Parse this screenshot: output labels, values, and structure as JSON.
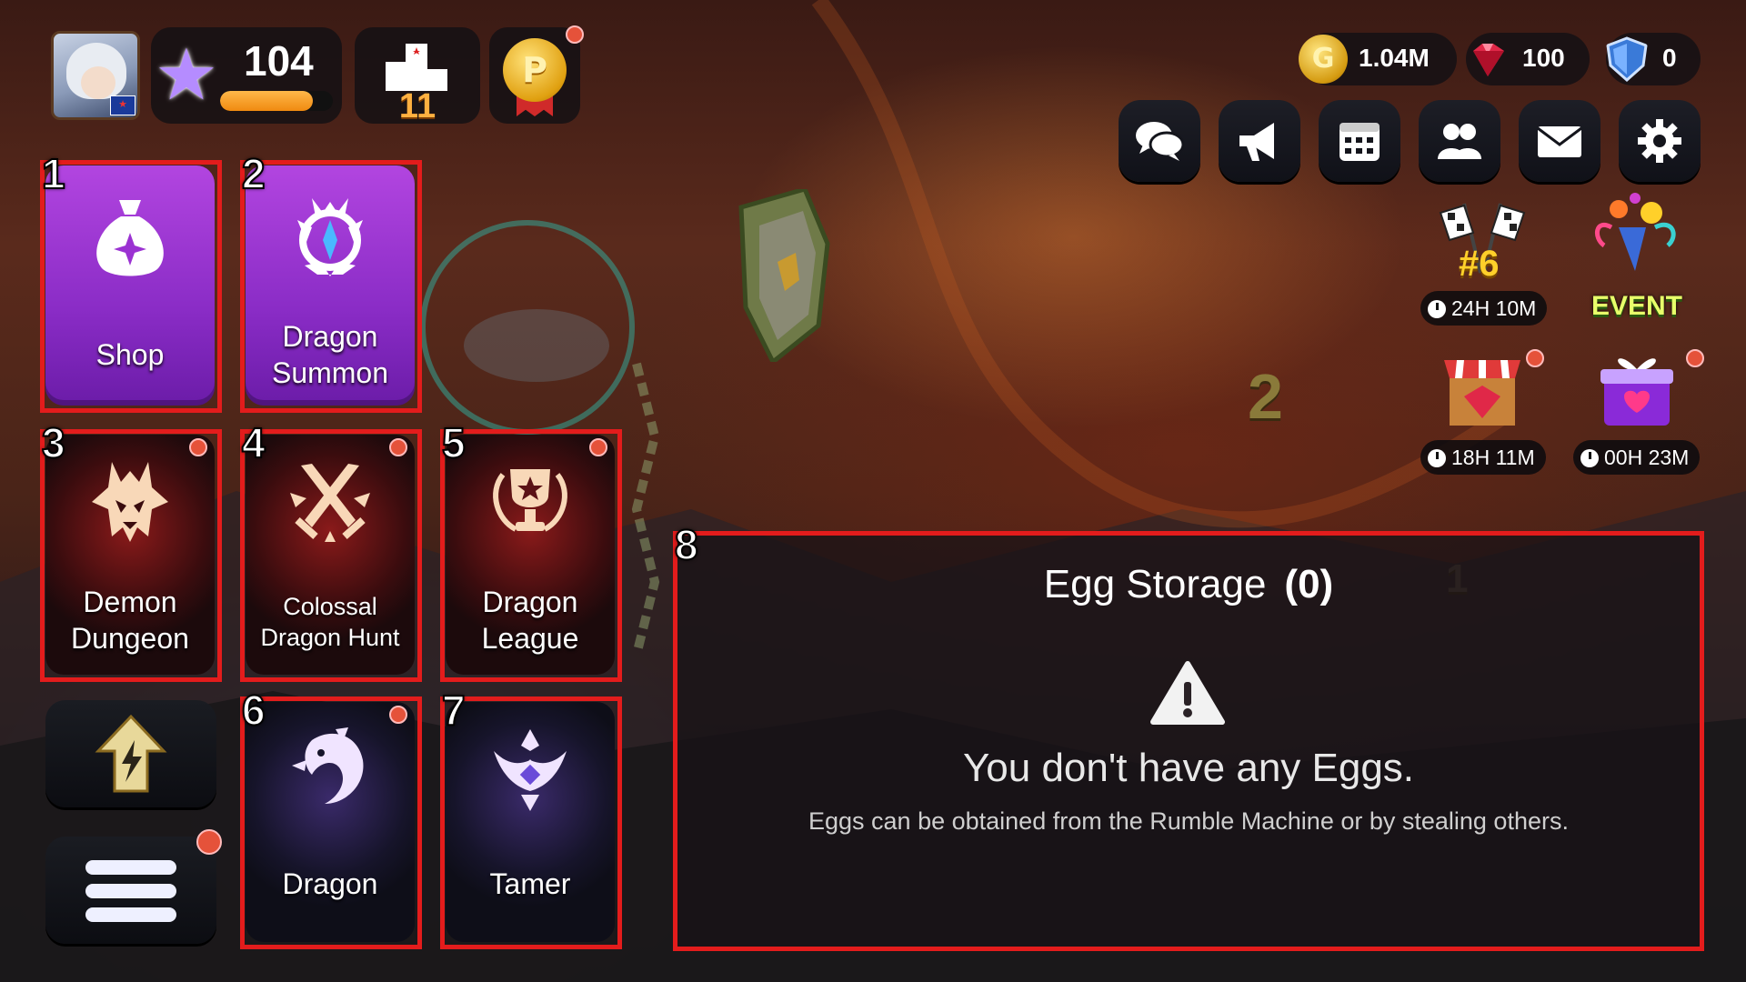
{
  "player": {
    "avatar_icon": "player-avatar",
    "country_flag": "australia-flag-icon",
    "level": "104",
    "xp_progress": 0.82,
    "rank": "11",
    "pass_letter": "P",
    "pass_has_notification": true
  },
  "currencies": {
    "gold": "1.04M",
    "gems": "100",
    "shields": "0"
  },
  "toolbar": [
    {
      "name": "chat-button",
      "icon": "chat-bubbles-icon"
    },
    {
      "name": "announcement-button",
      "icon": "megaphone-icon"
    },
    {
      "name": "calendar-button",
      "icon": "calendar-icon"
    },
    {
      "name": "friends-button",
      "icon": "friends-icon"
    },
    {
      "name": "mail-button",
      "icon": "envelope-icon"
    },
    {
      "name": "settings-button",
      "icon": "gear-icon"
    }
  ],
  "events": {
    "race": {
      "label": "#6",
      "timer": "24H 10M"
    },
    "event": {
      "label": "EVENT"
    },
    "shop_offer": {
      "timer": "18H 11M"
    },
    "gift": {
      "timer": "00H 23M"
    }
  },
  "menu": {
    "shop": {
      "label": "Shop",
      "marker": "1"
    },
    "dragon_summon": {
      "label": "Dragon Summon",
      "marker": "2"
    },
    "demon_dungeon": {
      "label": "Demon Dungeon",
      "marker": "3"
    },
    "colossal_hunt": {
      "label": "Colossal Dragon Hunt",
      "marker": "4"
    },
    "dragon_league": {
      "label": "Dragon League",
      "marker": "5"
    },
    "dragon": {
      "label": "Dragon",
      "marker": "6"
    },
    "tamer": {
      "label": "Tamer",
      "marker": "7"
    }
  },
  "egg_storage": {
    "marker": "8",
    "title": "Egg Storage",
    "count": "(0)",
    "empty_title": "You don't have any Eggs.",
    "empty_subtitle": "Eggs can be obtained from the Rumble Machine or by stealing others."
  },
  "scene": {
    "floating_number_1": "2",
    "floating_number_2": "1"
  },
  "colors": {
    "highlight": "#e31c1c",
    "card_purple": "#9b32d2",
    "card_red": "#5a1216",
    "notification": "#e5523a"
  }
}
